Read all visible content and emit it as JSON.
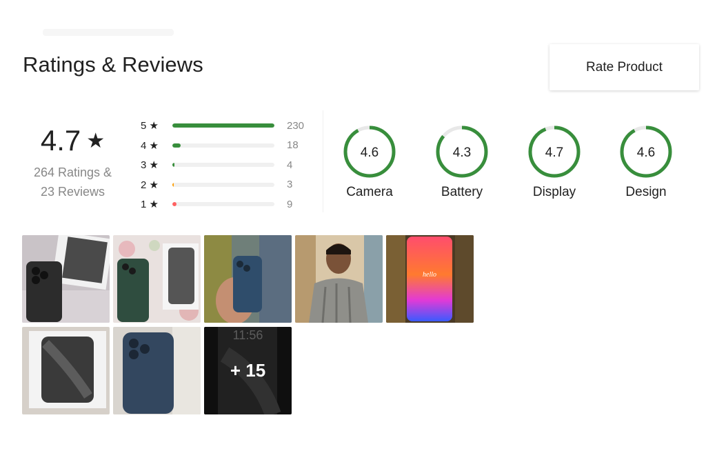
{
  "header": {
    "title": "Ratings & Reviews",
    "rate_button": "Rate Product"
  },
  "summary": {
    "average": "4.7",
    "star": "★",
    "ratings_text": "264 Ratings &",
    "reviews_text": "23 Reviews"
  },
  "distribution": [
    {
      "label": "5 ★",
      "count": "230",
      "fraction": 1.0,
      "color": "#388e3c"
    },
    {
      "label": "4 ★",
      "count": "18",
      "fraction": 0.078,
      "color": "#388e3c"
    },
    {
      "label": "3 ★",
      "count": "4",
      "fraction": 0.017,
      "color": "#388e3c"
    },
    {
      "label": "2 ★",
      "count": "3",
      "fraction": 0.013,
      "color": "#ff9f00"
    },
    {
      "label": "1 ★",
      "count": "9",
      "fraction": 0.039,
      "color": "#ff6161"
    }
  ],
  "features": [
    {
      "name": "Camera",
      "score": "4.6",
      "fraction": 0.92
    },
    {
      "name": "Battery",
      "score": "4.3",
      "fraction": 0.86
    },
    {
      "name": "Display",
      "score": "4.7",
      "fraction": 0.94
    },
    {
      "name": "Design",
      "score": "4.6",
      "fraction": 0.92
    }
  ],
  "colors": {
    "accent_green": "#388e3c",
    "ring_track": "#e8e8e8"
  },
  "photos": {
    "more_label": "+ 15",
    "clock_text": "11:56",
    "hello_text": "hello"
  }
}
